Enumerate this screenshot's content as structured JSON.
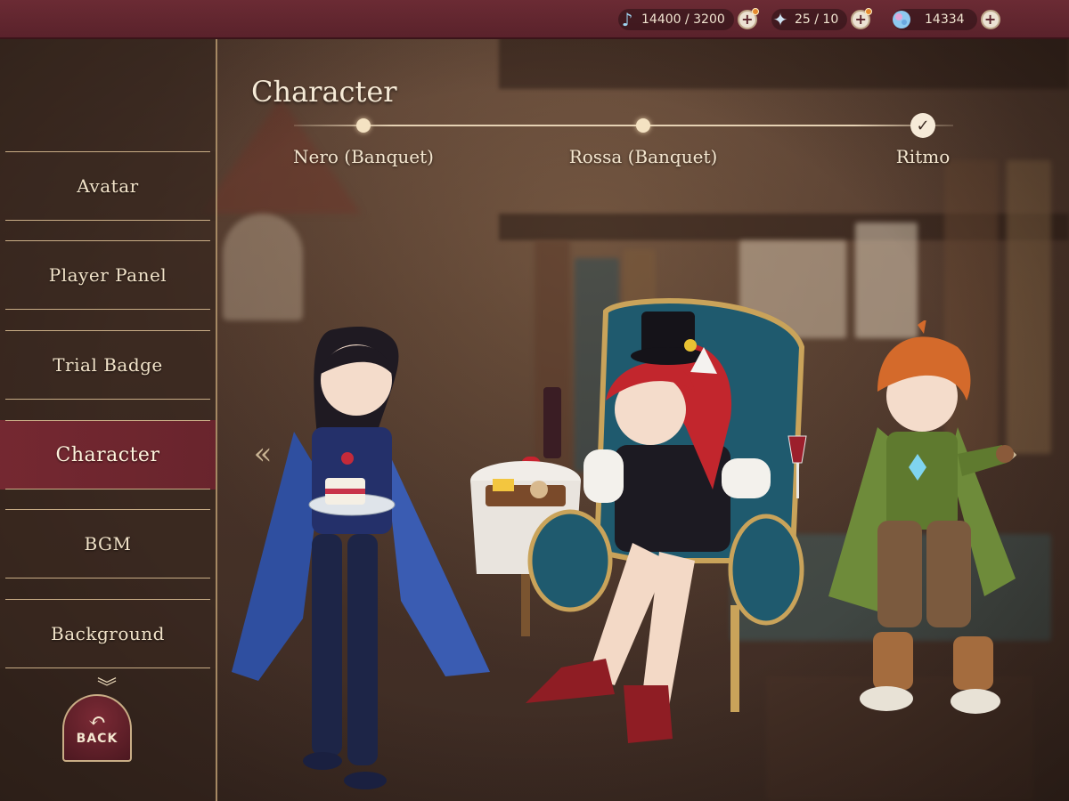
{
  "resources": [
    {
      "icon": "music-note-icon",
      "value": "14400 / 3200",
      "has_alert": true
    },
    {
      "icon": "stamina-wing-icon",
      "value": "25 /  10",
      "has_alert": true
    },
    {
      "icon": "crystal-orb-icon",
      "value": "14334",
      "has_alert": false
    }
  ],
  "sidebar": {
    "items": [
      {
        "label": "Avatar"
      },
      {
        "label": "Player Panel"
      },
      {
        "label": "Trial Badge"
      },
      {
        "label": "Character",
        "active": true
      },
      {
        "label": "BGM"
      },
      {
        "label": "Background"
      }
    ],
    "back_label": "BACK"
  },
  "main": {
    "title": "Character",
    "timeline": [
      {
        "label": "Nero (Banquet)",
        "state": "dot"
      },
      {
        "label": "Rossa (Banquet)",
        "state": "dot"
      },
      {
        "label": "Ritmo",
        "state": "checked"
      }
    ]
  },
  "colors": {
    "topbar": "#6b2b34",
    "active_tab": "#78283a",
    "accent_gold": "#c9ad86",
    "text_cream": "#f4e6cf"
  }
}
